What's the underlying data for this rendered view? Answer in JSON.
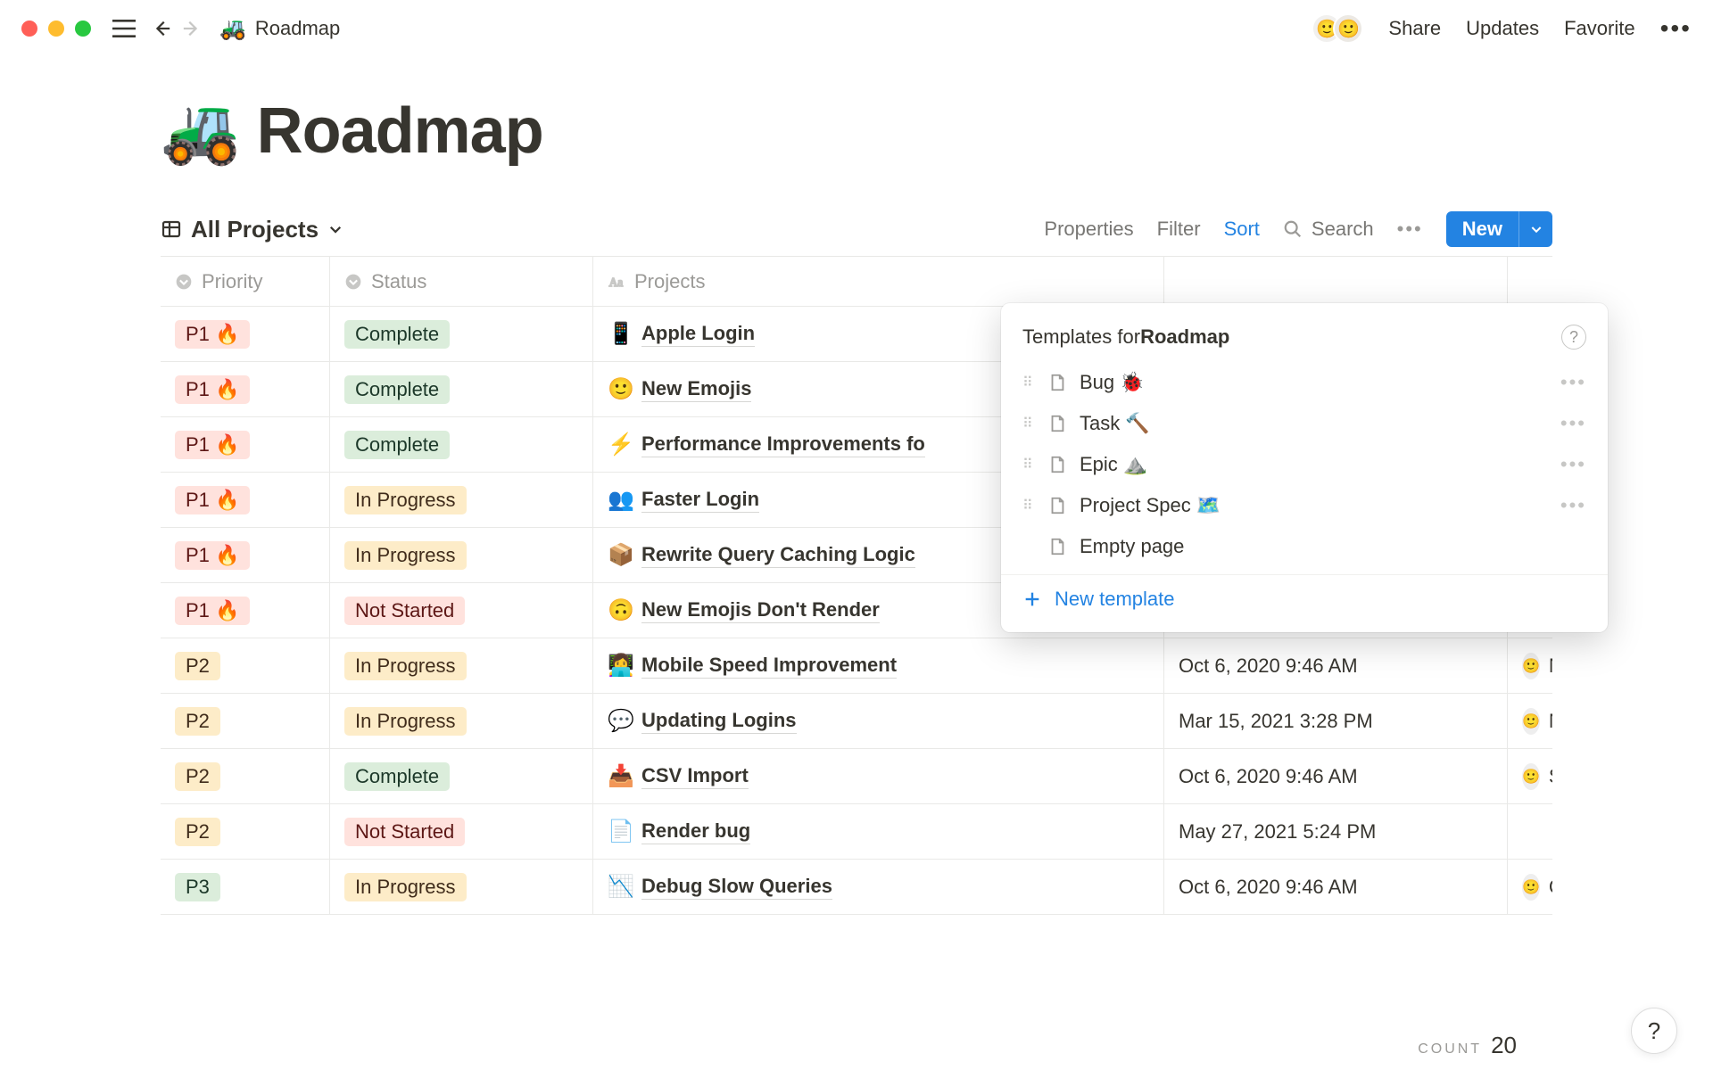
{
  "topbar": {
    "breadcrumb_emoji": "🚜",
    "breadcrumb_title": "Roadmap",
    "share": "Share",
    "updates": "Updates",
    "favorite": "Favorite"
  },
  "page": {
    "title_emoji": "🚜",
    "title": "Roadmap"
  },
  "viewbar": {
    "selector_label": "All Projects",
    "properties": "Properties",
    "filter": "Filter",
    "sort": "Sort",
    "search": "Search",
    "new_label": "New"
  },
  "columns": {
    "priority": "Priority",
    "status": "Status",
    "projects": "Projects"
  },
  "rows": [
    {
      "priority": "P1 🔥",
      "priority_class": "pill-p1",
      "status": "Complete",
      "status_class": "pill-complete",
      "emoji": "📱",
      "project": "Apple Login",
      "date": "",
      "owner": ""
    },
    {
      "priority": "P1 🔥",
      "priority_class": "pill-p1",
      "status": "Complete",
      "status_class": "pill-complete",
      "emoji": "🙂",
      "project": "New Emojis",
      "date": "",
      "owner": ""
    },
    {
      "priority": "P1 🔥",
      "priority_class": "pill-p1",
      "status": "Complete",
      "status_class": "pill-complete",
      "emoji": "⚡",
      "project": "Performance Improvements fo",
      "date": "",
      "owner": ""
    },
    {
      "priority": "P1 🔥",
      "priority_class": "pill-p1",
      "status": "In Progress",
      "status_class": "pill-inprogress",
      "emoji": "👥",
      "project": "Faster Login",
      "date": "",
      "owner": ""
    },
    {
      "priority": "P1 🔥",
      "priority_class": "pill-p1",
      "status": "In Progress",
      "status_class": "pill-inprogress",
      "emoji": "📦",
      "project": "Rewrite Query Caching Logic",
      "date": "",
      "owner": ""
    },
    {
      "priority": "P1 🔥",
      "priority_class": "pill-p1",
      "status": "Not Started",
      "status_class": "pill-notstarted",
      "emoji": "🙃",
      "project": "New Emojis Don't Render",
      "date": "",
      "owner": ""
    },
    {
      "priority": "P2",
      "priority_class": "pill-p2",
      "status": "In Progress",
      "status_class": "pill-inprogress",
      "emoji": "👩‍💻",
      "project": "Mobile Speed Improvement",
      "date": "Oct 6, 2020 9:46 AM",
      "owner": "Nate"
    },
    {
      "priority": "P2",
      "priority_class": "pill-p2",
      "status": "In Progress",
      "status_class": "pill-inprogress",
      "emoji": "💬",
      "project": "Updating Logins",
      "date": "Mar 15, 2021 3:28 PM",
      "owner": "Nate"
    },
    {
      "priority": "P2",
      "priority_class": "pill-p2",
      "status": "Complete",
      "status_class": "pill-complete",
      "emoji": "📥",
      "project": "CSV Import",
      "date": "Oct 6, 2020 9:46 AM",
      "owner": "Simon"
    },
    {
      "priority": "P2",
      "priority_class": "pill-p2",
      "status": "Not Started",
      "status_class": "pill-notstarted",
      "emoji": "📄",
      "project": "Render bug",
      "date": "May 27, 2021 5:24 PM",
      "owner": ""
    },
    {
      "priority": "P3",
      "priority_class": "pill-p3",
      "status": "In Progress",
      "status_class": "pill-inprogress",
      "emoji": "📉",
      "project": "Debug Slow Queries",
      "date": "Oct 6, 2020 9:46 AM",
      "owner": "Cory"
    }
  ],
  "popover": {
    "header_prefix": "Templates for ",
    "header_title": "Roadmap",
    "items": [
      {
        "label": "Bug 🐞",
        "draggable": true
      },
      {
        "label": "Task 🔨",
        "draggable": true
      },
      {
        "label": "Epic ⛰️",
        "draggable": true
      },
      {
        "label": "Project Spec 🗺️",
        "draggable": true
      },
      {
        "label": "Empty page",
        "draggable": false
      }
    ],
    "new_template": "New template"
  },
  "footer": {
    "label": "COUNT",
    "count": "20"
  }
}
